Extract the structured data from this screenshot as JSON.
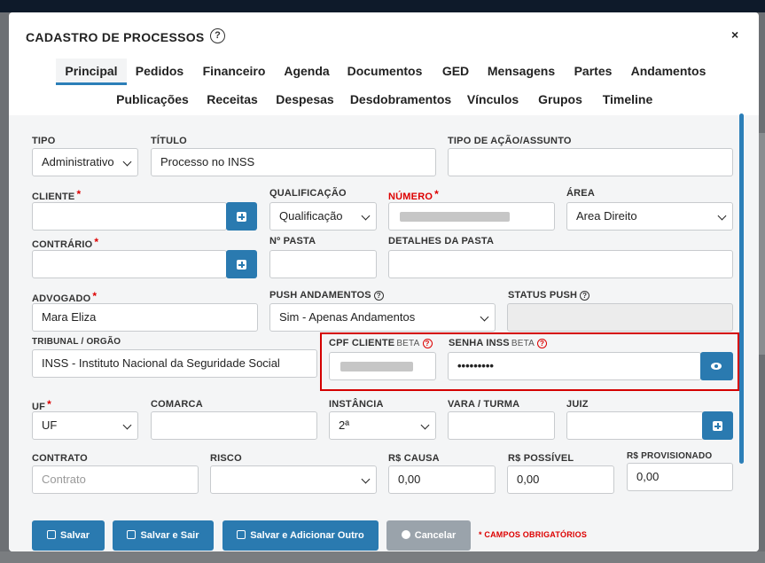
{
  "modal": {
    "title": "CADASTRO DE PROCESSOS",
    "help": "?",
    "close": "×"
  },
  "tabs_row1": [
    "Principal",
    "Pedidos",
    "Financeiro",
    "Agenda",
    "Documentos",
    "GED",
    "Mensagens",
    "Partes",
    "Andamentos"
  ],
  "tabs_row2": [
    "Publicações",
    "Receitas",
    "Despesas",
    "Desdobramentos",
    "Vínculos",
    "Grupos",
    "Timeline"
  ],
  "form": {
    "tipo": {
      "label": "TIPO",
      "value": "Administrativo"
    },
    "titulo": {
      "label": "TÍTULO",
      "value": "Processo no INSS"
    },
    "tipo_acao": {
      "label": "TIPO DE AÇÃO/ASSUNTO",
      "value": ""
    },
    "cliente": {
      "label": "CLIENTE",
      "required": "*",
      "value": ""
    },
    "qualificacao": {
      "label": "QUALIFICAÇÃO",
      "value": "Qualificação"
    },
    "numero": {
      "label": "NÚMERO",
      "required": "*",
      "value": ""
    },
    "area": {
      "label": "ÁREA",
      "value": "Area Direito"
    },
    "contrario": {
      "label": "CONTRÁRIO",
      "required": "*",
      "value": ""
    },
    "n_pasta": {
      "label": "Nº PASTA",
      "value": ""
    },
    "detalhes_pasta": {
      "label": "DETALHES DA PASTA",
      "value": ""
    },
    "advogado": {
      "label": "ADVOGADO",
      "required": "*",
      "value": "Mara Eliza"
    },
    "push_andamentos": {
      "label": "PUSH ANDAMENTOS",
      "help": "?",
      "value": "Sim - Apenas Andamentos"
    },
    "status_push": {
      "label": "STATUS PUSH",
      "help": "?",
      "value": ""
    },
    "tribunal": {
      "label": "TRIBUNAL / ORGÃO",
      "value": "INSS - Instituto Nacional da Seguridade Social"
    },
    "cpf_cliente": {
      "label": "CPF CLIENTE",
      "beta": "BETA",
      "help": "?",
      "value": ""
    },
    "senha_inss": {
      "label": "SENHA INSS",
      "beta": "BETA",
      "help": "?",
      "value": "•••••••••"
    },
    "uf": {
      "label": "UF",
      "required": "*",
      "value": "UF"
    },
    "comarca": {
      "label": "COMARCA",
      "value": ""
    },
    "instancia": {
      "label": "INSTÂNCIA",
      "value": "2ª"
    },
    "vara_turma": {
      "label": "VARA / TURMA",
      "value": ""
    },
    "juiz": {
      "label": "JUIZ",
      "value": ""
    },
    "contrato": {
      "label": "CONTRATO",
      "placeholder": "Contrato"
    },
    "risco": {
      "label": "RISCO",
      "value": ""
    },
    "rs_causa": {
      "label": "R$ CAUSA",
      "value": "0,00"
    },
    "rs_possivel": {
      "label": "R$ POSSÍVEL",
      "value": "0,00"
    },
    "rs_provisionado": {
      "label": "R$ PROVISIONADO",
      "value": "0,00"
    }
  },
  "buttons": {
    "salvar": "Salvar",
    "salvar_sair": "Salvar e Sair",
    "salvar_adicionar": "Salvar e Adicionar Outro",
    "cancelar": "Cancelar"
  },
  "required_note": "* CAMPOS OBRIGATÓRIOS",
  "colors": {
    "primary": "#2a7ab0",
    "required": "#d00",
    "highlight": "#d40000",
    "disabled_button": "#9aa3ab"
  }
}
